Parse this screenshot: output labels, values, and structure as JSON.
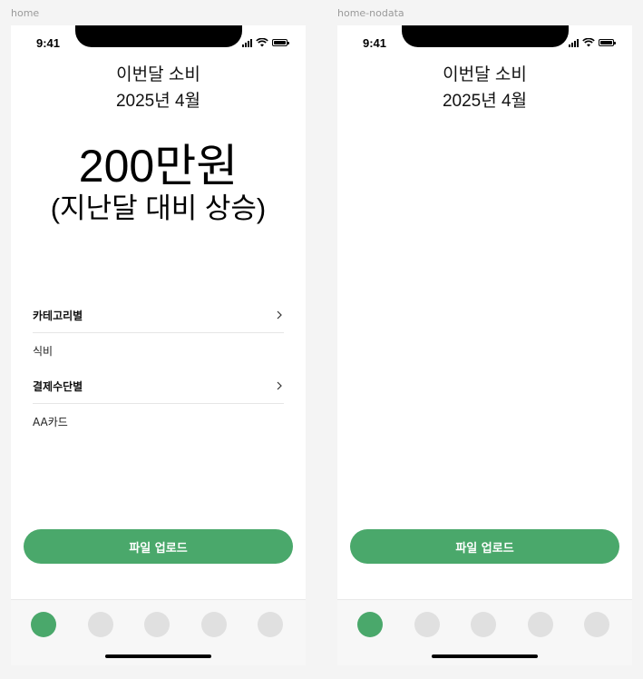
{
  "screens": [
    {
      "frame_label": "home",
      "status_time": "9:41",
      "title": "이번달 소비",
      "period": "2025년 4월",
      "amount": "200만원",
      "comparison": "(지난달 대비 상승)",
      "sections": [
        {
          "header": "카테고리별",
          "item": "식비"
        },
        {
          "header": "결제수단별",
          "item": "AA카드"
        }
      ],
      "upload_label": "파일 업로드",
      "active_tab": 0
    },
    {
      "frame_label": "home-nodata",
      "status_time": "9:41",
      "title": "이번달 소비",
      "period": "2025년 4월",
      "upload_label": "파일 업로드",
      "active_tab": 0
    }
  ],
  "icons": {
    "chevron": "chevron-right-icon",
    "signal": "cellular-signal-icon",
    "wifi": "wifi-icon",
    "battery": "battery-icon"
  },
  "colors": {
    "accent": "#4aa86b",
    "tab_inactive": "#e0e0e0"
  }
}
